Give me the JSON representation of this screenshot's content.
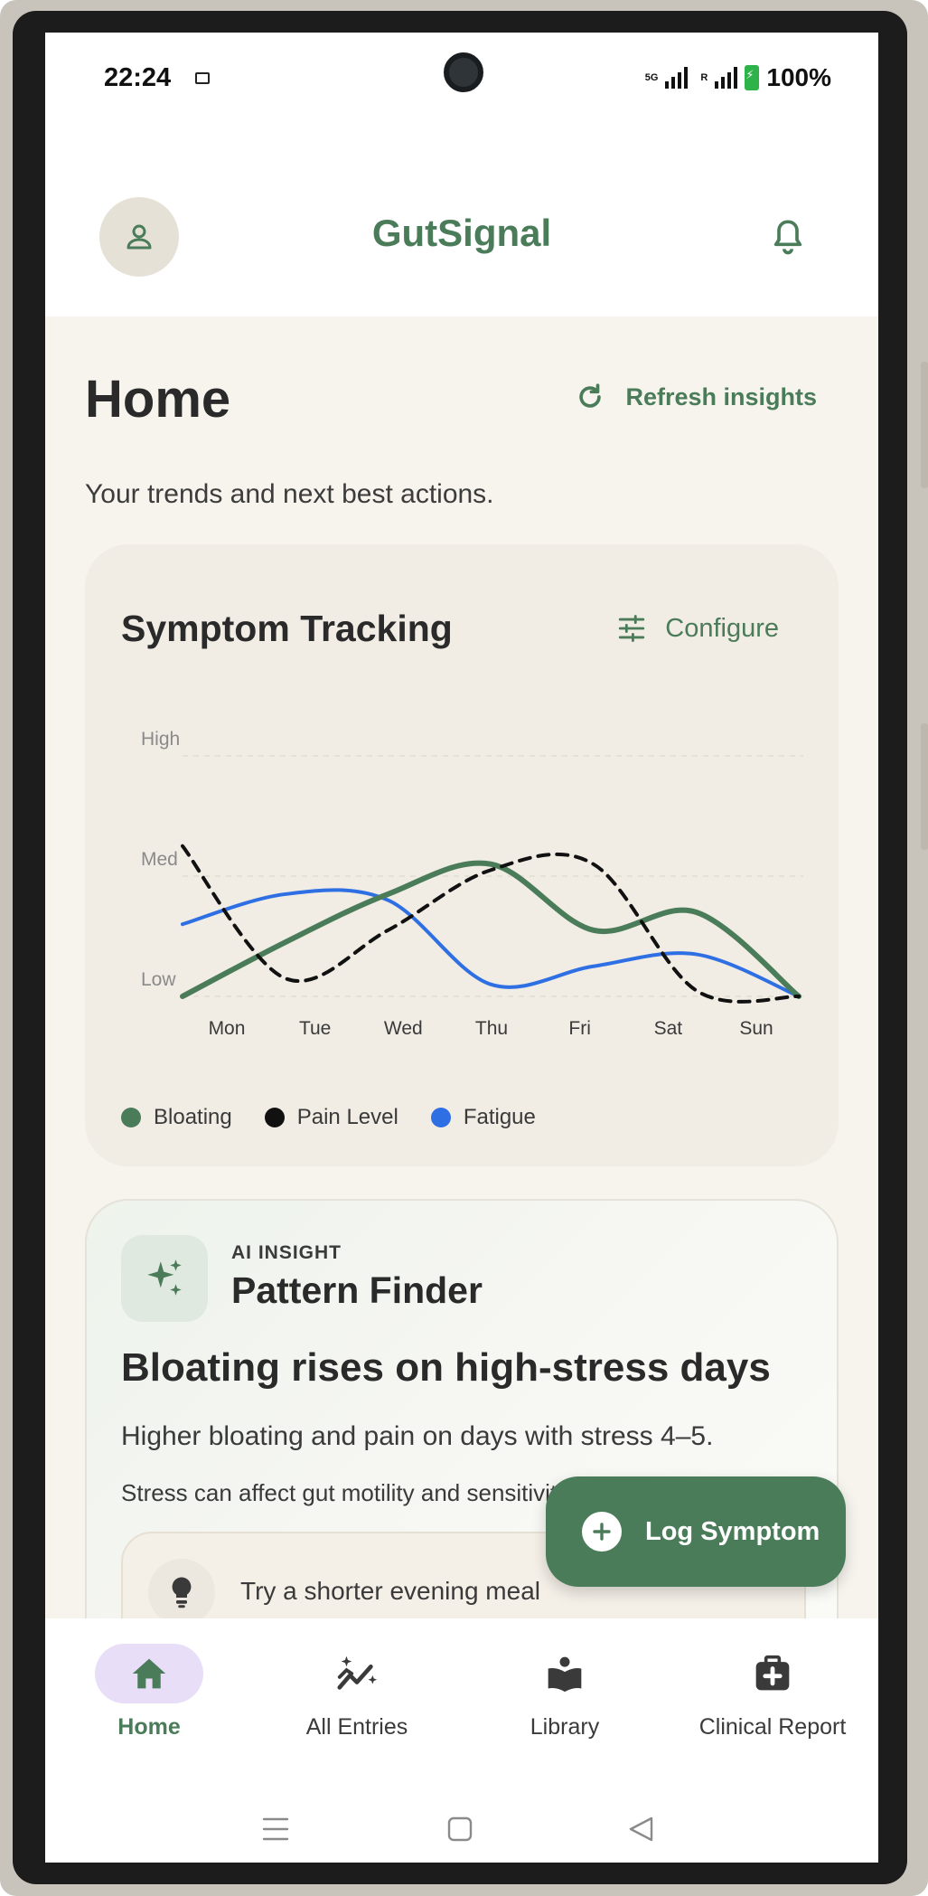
{
  "status_bar": {
    "time": "22:24",
    "network": "5G",
    "roaming": "R",
    "battery": "100%"
  },
  "app": {
    "brand": "GutSignal"
  },
  "home": {
    "title": "Home",
    "refresh_label": "Refresh insights",
    "subtitle": "Your trends and next best actions."
  },
  "symptom_card": {
    "title": "Symptom Tracking",
    "configure_label": "Configure"
  },
  "chart_data": {
    "type": "line",
    "categories": [
      "Mon",
      "Tue",
      "Wed",
      "Thu",
      "Fri",
      "Sat",
      "Sun"
    ],
    "y_ticks": [
      "Low",
      "Med",
      "High"
    ],
    "ylim": [
      0,
      2
    ],
    "grid": true,
    "legend_position": "bottom",
    "series": [
      {
        "name": "Bloating",
        "color": "#4a7c59",
        "style": "solid",
        "values": [
          0.0,
          0.45,
          0.85,
          1.1,
          0.55,
          0.7,
          0.0
        ]
      },
      {
        "name": "Pain Level",
        "color": "#111111",
        "style": "dashed",
        "values": [
          1.25,
          0.15,
          0.55,
          1.05,
          1.1,
          0.05,
          0.0
        ]
      },
      {
        "name": "Fatigue",
        "color": "#2f6fe4",
        "style": "solid",
        "values": [
          0.6,
          0.85,
          0.8,
          0.1,
          0.25,
          0.35,
          0.0
        ]
      }
    ]
  },
  "insight_card": {
    "label": "AI INSIGHT",
    "name": "Pattern Finder",
    "headline": "Bloating rises on high-stress days",
    "body": "Higher bloating and pain on days with stress 4–5.",
    "reason": "Stress can affect gut motility and sensitivity.",
    "tip": "Try a shorter evening meal"
  },
  "fab": {
    "label": "Log Symptom"
  },
  "bottom_nav": [
    {
      "label": "Home",
      "icon": "home-icon",
      "active": true
    },
    {
      "label": "All Entries",
      "icon": "trend-sparkle-icon",
      "active": false
    },
    {
      "label": "Library",
      "icon": "library-icon",
      "active": false
    },
    {
      "label": "Clinical Report",
      "icon": "medical-case-icon",
      "active": false
    }
  ],
  "colors": {
    "accent": "#4a7c59",
    "background": "#f7f4ee",
    "nav_active_pill": "#e8def8"
  }
}
